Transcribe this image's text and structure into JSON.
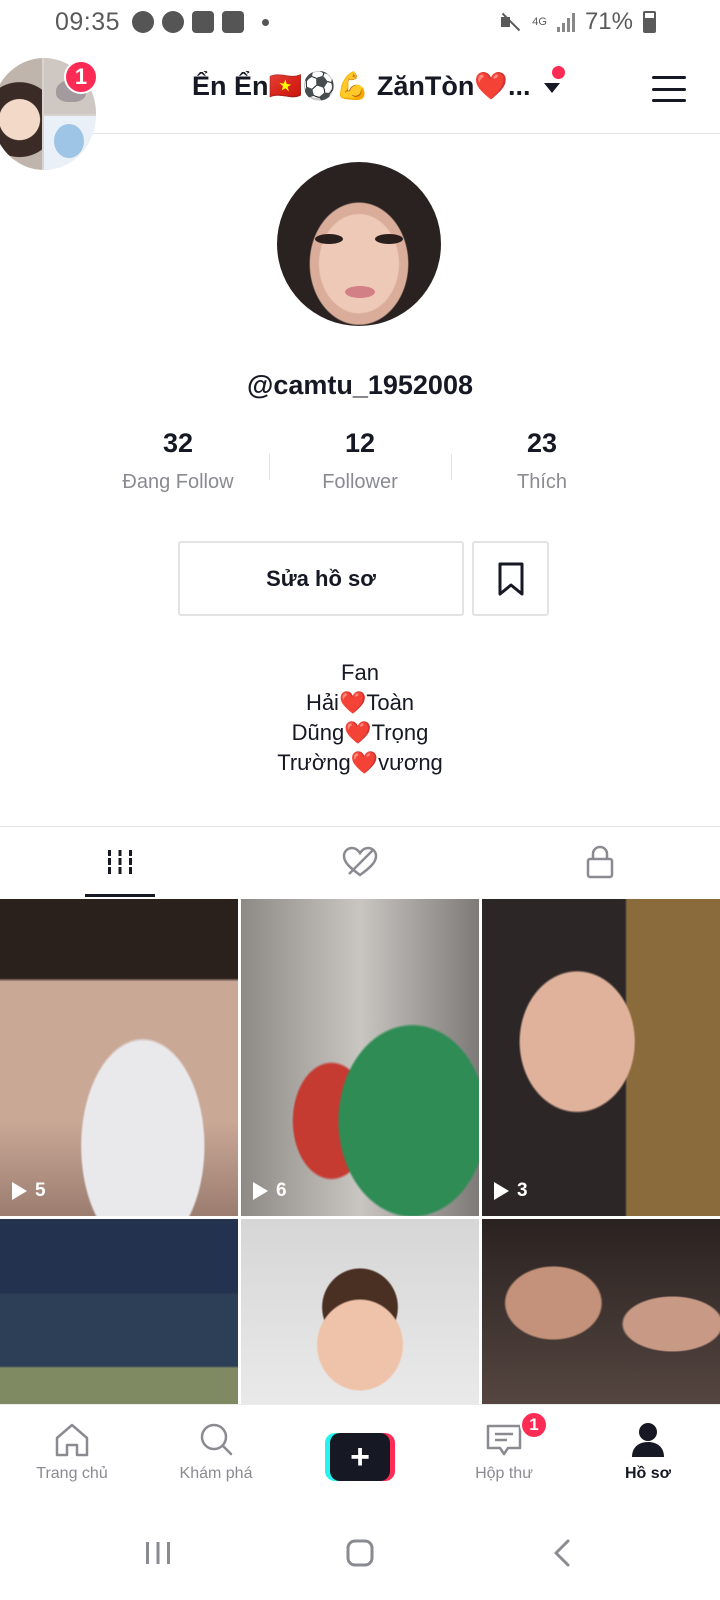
{
  "status_bar": {
    "time": "09:35",
    "network": "4G",
    "battery": "71%"
  },
  "header": {
    "account_name": "Ển Ển🇻🇳⚽💪 ZănTòn❤️...",
    "notification_count": "1"
  },
  "profile": {
    "username": "@camtu_1952008",
    "stats": [
      {
        "value": "32",
        "label": "Đang Follow"
      },
      {
        "value": "12",
        "label": "Follower"
      },
      {
        "value": "23",
        "label": "Thích"
      }
    ],
    "edit_button": "Sửa hồ sơ",
    "bio": [
      "Fan",
      "Hải❤️Toàn",
      "Dũng❤️Trọng",
      "Trường❤️vương"
    ]
  },
  "tabs": [
    {
      "icon": "video-grid-icon",
      "active": true
    },
    {
      "icon": "hidden-heart-icon",
      "active": false
    },
    {
      "icon": "lock-icon",
      "active": false
    }
  ],
  "videos": [
    {
      "plays": "5"
    },
    {
      "plays": "6"
    },
    {
      "plays": "3"
    },
    {
      "plays": ""
    },
    {
      "plays": ""
    },
    {
      "plays": ""
    }
  ],
  "bottom_nav": {
    "home": "Trang chủ",
    "discover": "Khám phá",
    "inbox": "Hộp thư",
    "inbox_badge": "1",
    "profile": "Hồ sơ"
  },
  "colors": {
    "accent": "#fe2c55",
    "cyan": "#25f4ee",
    "text": "#161823",
    "muted": "#8a8b91"
  }
}
